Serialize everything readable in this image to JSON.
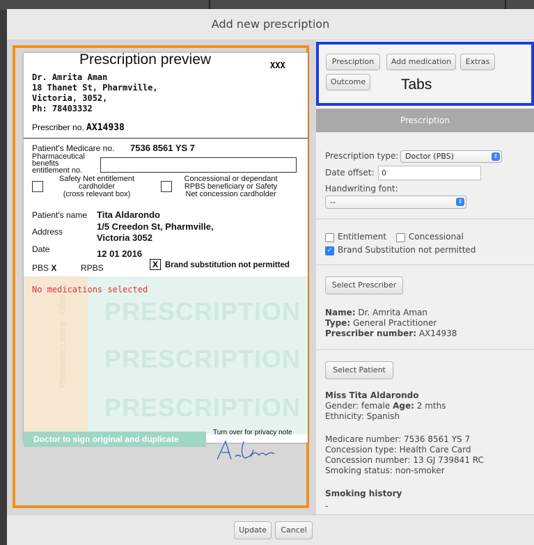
{
  "window": {
    "title": "Add new prescription"
  },
  "preview": {
    "label": "Prescription preview",
    "xxx": "XXX",
    "doctor_lines": [
      "Dr. Amrita Aman",
      "18 Thanet St, Pharmville,",
      "Victoria, 3052,",
      "Ph: 78403332"
    ],
    "prescriber_label": "Prescriber no.",
    "prescriber_no": "AX14938",
    "medicare_label": "Patient's Medicare no.",
    "medicare_no": "7536 8561 YS 7",
    "pharma_label_1": "Pharmaceutical",
    "pharma_label_2": "benefits",
    "pharma_label_3": "entitlement no.",
    "safety_1": "Safety Net entitlement",
    "safety_2": "cardholder",
    "safety_3": "(cross relevant box)",
    "concession_1": "Concessional or dependant",
    "concession_2": "RPBS beneficiary or Safety",
    "concession_3": "Net concession cardholder",
    "patient_name_label": "Patient's name",
    "patient_name": "Tita Aldarondo",
    "address_label": "Address",
    "address_1": "1/5 Creedon St, Pharmville,",
    "address_2": "Victoria 3052",
    "date_label": "Date",
    "date": "12 01 2016",
    "pbs": "PBS",
    "pbs_mark": "X",
    "rpbs": "RPBS",
    "brand_mark": "X",
    "brand_label": "Brand substitution not permitted",
    "no_meds": "No medications selected",
    "watermark": "PRESCRIPTION",
    "vertical_text": "Pharmacist's stamp · Office",
    "sign_bar": "Doctor to sign original and duplicate",
    "privacy": "Turn over for privacy note"
  },
  "tabs": {
    "label": "Tabs",
    "items": [
      "Presciption",
      "Add medication",
      "Extras",
      "Outcome"
    ]
  },
  "form": {
    "section_title": "Prescription",
    "type_label": "Prescription type:",
    "type_value": "Doctor (PBS)",
    "date_offset_label": "Date offset:",
    "date_offset_value": "0",
    "handwriting_label": "Handwriting font:",
    "handwriting_value": "--",
    "entitlement": "Entitlement",
    "concessional": "Concessional",
    "brand_sub": "Brand Substitution not permitted",
    "select_prescriber": "Select Prescriber",
    "prescriber_name_k": "Name:",
    "prescriber_name_v": "Dr. Amrita Aman",
    "prescriber_type_k": "Type:",
    "prescriber_type_v": "General Practitioner",
    "prescriber_num_k": "Prescriber number:",
    "prescriber_num_v": "AX14938",
    "select_patient": "Select Patient",
    "patient_name": "Miss Tita Aldarondo",
    "gender_k": "Gender:",
    "gender_v": "female",
    "age_k": "Age:",
    "age_v": "2 mths",
    "ethnicity_k": "Ethnicity:",
    "ethnicity_v": "Spanish",
    "medicare_k": "Medicare number:",
    "medicare_v": "7536 8561 YS 7",
    "conc_type_k": "Concession type:",
    "conc_type_v": "Health Care Card",
    "conc_num_k": "Concession number:",
    "conc_num_v": "13 GJ 739841 RC",
    "smoking_k": "Smoking status:",
    "smoking_v": "non-smoker",
    "smoking_history": "Smoking history",
    "smoking_history_v": "-"
  },
  "footer": {
    "update": "Update",
    "cancel": "Cancel"
  },
  "colors": {
    "annotation_orange": "#f0901e",
    "annotation_blue": "#1b3fdc",
    "checkbox_blue": "#2f7cf6",
    "error_red": "#e0332e"
  }
}
